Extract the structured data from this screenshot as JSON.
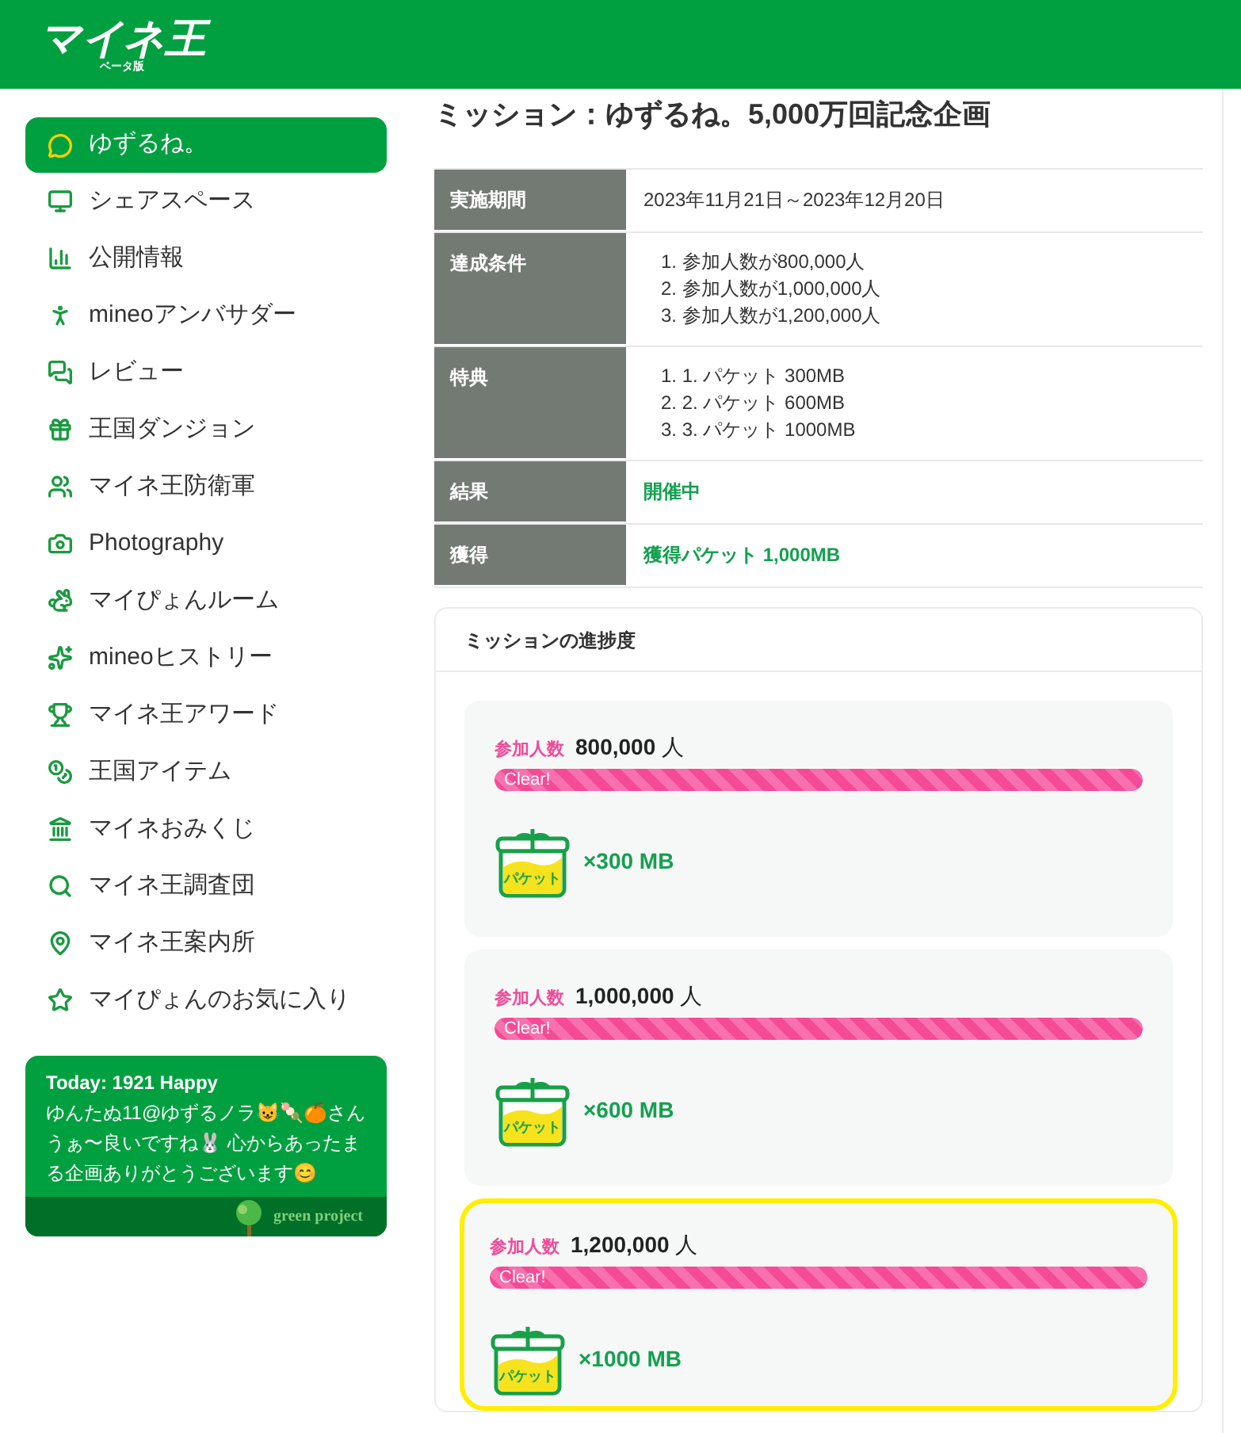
{
  "header": {
    "logo": "マイネ王",
    "logo_sub": "ベータ版"
  },
  "sidebar": {
    "items": [
      {
        "label": "ゆずるね。",
        "selected": true
      },
      {
        "label": "シェアスペース",
        "selected": false
      },
      {
        "label": "公開情報",
        "selected": false
      },
      {
        "label": "mineoアンバサダー",
        "selected": false
      },
      {
        "label": "レビュー",
        "selected": false
      },
      {
        "label": "王国ダンジョン",
        "selected": false
      },
      {
        "label": "マイネ王防衛軍",
        "selected": false
      },
      {
        "label": "Photography",
        "selected": false
      },
      {
        "label": "マイぴょんルーム",
        "selected": false
      },
      {
        "label": "mineoヒストリー",
        "selected": false
      },
      {
        "label": "マイネ王アワード",
        "selected": false
      },
      {
        "label": "王国アイテム",
        "selected": false
      },
      {
        "label": "マイネおみくじ",
        "selected": false
      },
      {
        "label": "マイネ王調査団",
        "selected": false
      },
      {
        "label": "マイネ王案内所",
        "selected": false
      },
      {
        "label": "マイぴょんのお気に入り",
        "selected": false
      }
    ],
    "today": {
      "title": "Today: 1921 Happy",
      "message": "ゆんたぬ11@ゆずるノラ😺🍡🍊さんうぁ〜良いですね🐰 心からあったまる企画ありがとうございます😊",
      "footer": "green project"
    }
  },
  "mission": {
    "title": "ミッション：ゆずるね。5,000万回記念企画",
    "rows": [
      {
        "label": "実施期間",
        "kind": "text",
        "value": "2023年11月21日～2023年12月20日"
      },
      {
        "label": "達成条件",
        "kind": "list",
        "items": [
          "参加人数が800,000人",
          "参加人数が1,000,000人",
          "参加人数が1,200,000人"
        ],
        "markers": [
          "1.",
          "2.",
          "3."
        ]
      },
      {
        "label": "特典",
        "kind": "list",
        "items": [
          "1. パケット 300MB",
          "2. パケット 600MB",
          "3. パケット 1000MB"
        ],
        "markers": [
          "1.",
          "2.",
          "3."
        ]
      },
      {
        "label": "結果",
        "kind": "accent",
        "value": "開催中"
      },
      {
        "label": "獲得",
        "kind": "accent",
        "value": "獲得パケット 1,000MB"
      }
    ]
  },
  "progress": {
    "title": "ミッションの進捗度",
    "milestones": [
      {
        "label": "参加人数",
        "count": "800,000",
        "unit": "人",
        "bar_text": "Clear!",
        "level": 1,
        "icon_label": "パケット",
        "reward": "×300 MB",
        "highlighted": false
      },
      {
        "label": "参加人数",
        "count": "1,000,000",
        "unit": "人",
        "bar_text": "Clear!",
        "level": 1,
        "icon_label": "パケット",
        "reward": "×600 MB",
        "highlighted": false
      },
      {
        "label": "参加人数",
        "count": "1,200,000",
        "unit": "人",
        "bar_text": "Clear!",
        "level": 1,
        "icon_label": "パケット",
        "reward": "×1000 MB",
        "highlighted": true
      }
    ]
  }
}
